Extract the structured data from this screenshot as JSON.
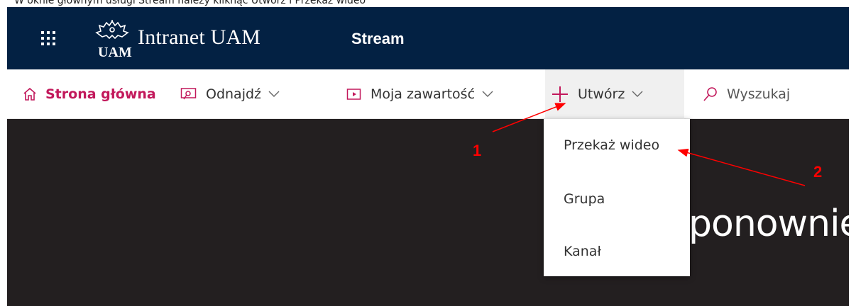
{
  "caption": "W oknie głównym usługi Stream należy kliknąć Utwórz i Przekaż wideo",
  "topbar": {
    "waffle_icon": "app-launcher-icon",
    "logo_icon": "uam-eagle-logo",
    "brand": "Intranet UAM",
    "app_name": "Stream"
  },
  "nav": {
    "home": {
      "label": "Strona główna",
      "icon": "home-icon"
    },
    "find": {
      "label": "Odnajdź",
      "icon": "discover-icon"
    },
    "content": {
      "label": "Moja zawartość",
      "icon": "video-icon"
    },
    "create": {
      "label": "Utwórz",
      "icon": "plus-icon"
    },
    "search": {
      "label": "Wyszukaj",
      "icon": "search-icon"
    }
  },
  "dropdown": {
    "items": [
      {
        "label": "Przekaż wideo"
      },
      {
        "label": "Grupa"
      },
      {
        "label": "Kanał"
      }
    ]
  },
  "hero": {
    "text": "ponownie,"
  },
  "annotations": {
    "label_1": "1",
    "label_2": "2"
  },
  "colors": {
    "topbar": "#032143",
    "accent": "#c2185b",
    "hero": "#231f20",
    "annotation": "#ff0000"
  }
}
